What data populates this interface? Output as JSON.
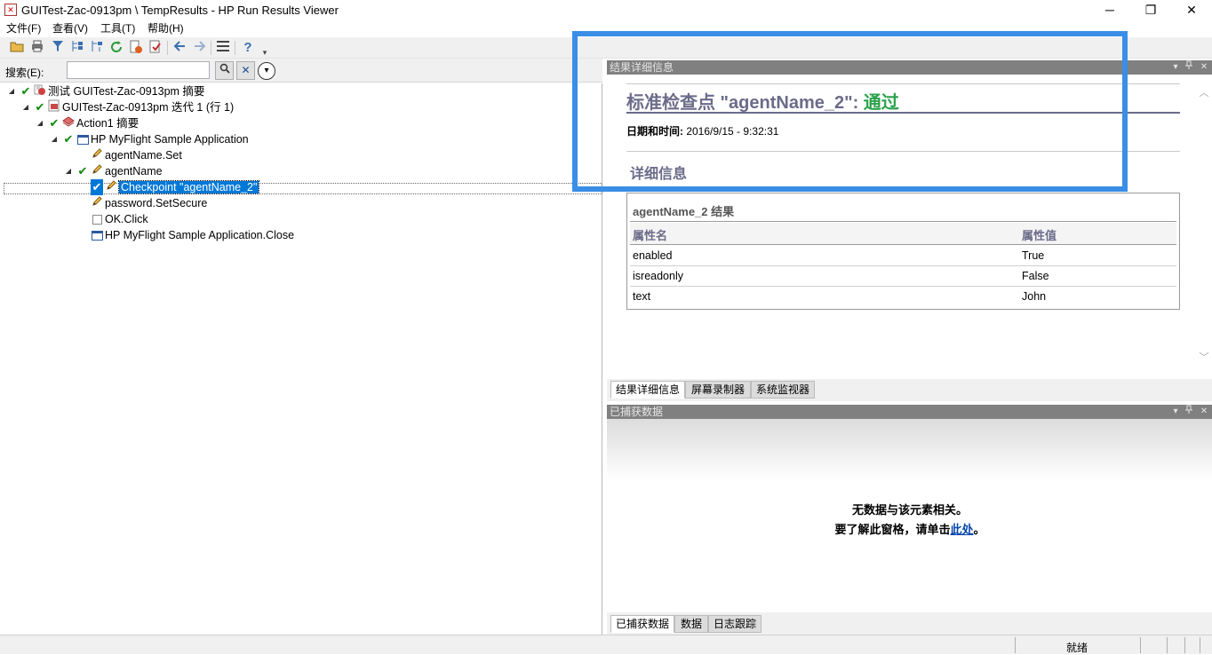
{
  "window": {
    "title": "GUITest-Zac-0913pm \\ TempResults - HP Run Results Viewer",
    "minimize": "─",
    "restore": "❐",
    "close": "✕"
  },
  "menu": [
    {
      "label": "文件(F)"
    },
    {
      "label": "查看(V)"
    },
    {
      "label": "工具(T)"
    },
    {
      "label": "帮助(H)"
    }
  ],
  "toolbar": {
    "icons": [
      "open-folder-icon",
      "print-icon",
      "filter-icon",
      "expand-all-icon",
      "collapse-all-icon",
      "refresh-icon",
      "export-icon",
      "add-icon",
      "back-arrow-icon",
      "forward-arrow-icon",
      "list-icon",
      "help-icon"
    ]
  },
  "search": {
    "label": "搜索(E):",
    "value": "",
    "search_btn": "🔍",
    "clear_btn": "✕",
    "options_btn": "▾"
  },
  "tree": [
    {
      "expander": "◢",
      "check": true,
      "icon": "test-icon",
      "label": "测试 GUITest-Zac-0913pm 摘要",
      "level": 0
    },
    {
      "expander": "◢",
      "check": true,
      "icon": "iteration-icon",
      "label": "GUITest-Zac-0913pm 迭代 1 (行 1)",
      "level": 1
    },
    {
      "expander": "◢",
      "check": true,
      "icon": "action-icon",
      "label": "Action1 摘要",
      "level": 2
    },
    {
      "expander": "◢",
      "check": true,
      "icon": "window-icon",
      "label": "HP MyFlight Sample Application",
      "level": 3
    },
    {
      "expander": "",
      "check": false,
      "icon": "pencil-icon",
      "label": "agentName.Set",
      "level": 4
    },
    {
      "expander": "◢",
      "check": true,
      "icon": "pencil-icon",
      "label": "agentName",
      "level": 4
    },
    {
      "expander": "",
      "check": true,
      "icon": "pencil-icon",
      "label": "Checkpoint \"agentName_2\"",
      "level": 5,
      "selected": true
    },
    {
      "expander": "",
      "check": false,
      "icon": "pencil-icon",
      "label": "password.SetSecure",
      "level": 4
    },
    {
      "expander": "",
      "check": false,
      "icon": "checkbox-icon",
      "label": "OK.Click",
      "level": 4
    },
    {
      "expander": "",
      "check": false,
      "icon": "window-icon",
      "label": "HP MyFlight Sample Application.Close",
      "level": 4
    }
  ],
  "details_pane": {
    "header": "结果详细信息",
    "title_prefix": "标准检查点 \"agentName_2\": ",
    "title_status": "通过",
    "date_label": "日期和时间:",
    "date_value": " 2016/9/15 - 9:32:31",
    "details_heading": "详细信息",
    "table": {
      "title": "agentName_2 结果",
      "col1": "属性名",
      "col2": "属性值",
      "rows": [
        {
          "name": "enabled",
          "value": "True"
        },
        {
          "name": "isreadonly",
          "value": "False"
        },
        {
          "name": "text",
          "value": "John"
        }
      ]
    },
    "tabs": [
      "结果详细信息",
      "屏幕录制器",
      "系统监视器"
    ]
  },
  "capture_pane": {
    "header": "已捕获数据",
    "line1": "无数据与该元素相关。",
    "line2_prefix": "要了解此窗格，请单击",
    "line2_link": "此处",
    "line2_suffix": "。",
    "tabs": [
      "已捕获数据",
      "数据",
      "日志跟踪"
    ]
  },
  "pane_controls": {
    "dropdown": "▾",
    "pin": "ꟷ",
    "close": "✕"
  },
  "status": {
    "text": "就绪"
  },
  "colors": {
    "highlight": "#3a8ee6",
    "pass": "#2aa14a",
    "check": "#0a8a0a",
    "selection": "#0078d7"
  }
}
